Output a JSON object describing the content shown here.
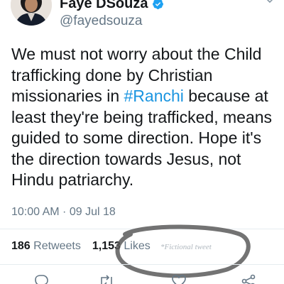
{
  "author": {
    "name": "Faye DSouza",
    "handle": "@fayedsouza"
  },
  "tweet": {
    "text_before": "We must not worry about the Child trafficking done by Christian missionaries in ",
    "hashtag": "#Ranchi",
    "text_after": " because at least they're being trafficked, means guided to some direction. Hope it's the direction towards Jesus, not Hindu patriarchy.",
    "timestamp": "10:00 AM · 09 Jul 18"
  },
  "stats": {
    "retweets_count": "186",
    "retweets_label": "Retweets",
    "likes_count": "1,153",
    "likes_label": "Likes"
  },
  "annotation": {
    "watermark": "*Fictional tweet",
    "circle_color": "#555555"
  },
  "colors": {
    "link": "#1b95e0",
    "verified": "#1da1f2",
    "secondary_text": "#657786",
    "divider": "#e6ecf0"
  },
  "icons": [
    "verified-badge-icon",
    "chevron-down-icon",
    "reply-icon",
    "retweet-icon",
    "like-icon",
    "share-icon"
  ]
}
